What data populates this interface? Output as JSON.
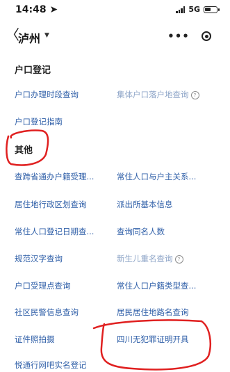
{
  "status_bar": {
    "time": "14:48",
    "network": "5G"
  },
  "nav": {
    "city": "泸州"
  },
  "sections": [
    {
      "title": "户口登记",
      "items": [
        {
          "label": "户口办理时段查询",
          "dim": false,
          "info": false
        },
        {
          "label": "集体户口落户地查询",
          "dim": true,
          "info": true
        },
        {
          "label": "户口登记指南",
          "dim": false,
          "info": false
        }
      ]
    },
    {
      "title": "其他",
      "items": [
        {
          "label": "查跨省通办户籍受理...",
          "dim": false,
          "info": false
        },
        {
          "label": "常住人口与户主关系...",
          "dim": false,
          "info": false
        },
        {
          "label": "居住地行政区划查询",
          "dim": false,
          "info": false
        },
        {
          "label": "派出所基本信息",
          "dim": false,
          "info": false
        },
        {
          "label": "常住人口登记日期查...",
          "dim": false,
          "info": false
        },
        {
          "label": "查询同名人数",
          "dim": false,
          "info": false
        },
        {
          "label": "规范汉字查询",
          "dim": false,
          "info": false
        },
        {
          "label": "新生儿重名查询",
          "dim": true,
          "info": true
        },
        {
          "label": "户口受理点查询",
          "dim": false,
          "info": false
        },
        {
          "label": "常住人口户籍类型查...",
          "dim": false,
          "info": false
        },
        {
          "label": "社区民警信息查询",
          "dim": false,
          "info": false
        },
        {
          "label": "居民居住地路名查询",
          "dim": false,
          "info": false
        },
        {
          "label": "证件照拍摄",
          "dim": false,
          "info": false
        },
        {
          "label": "四川无犯罪证明开具",
          "dim": false,
          "info": false
        },
        {
          "label": "悦通行网吧实名登记",
          "dim": false,
          "info": false
        }
      ]
    }
  ],
  "colors": {
    "link": "#2f5fa8",
    "link_dim": "#8fa6c8",
    "annotation": "#e02020"
  }
}
